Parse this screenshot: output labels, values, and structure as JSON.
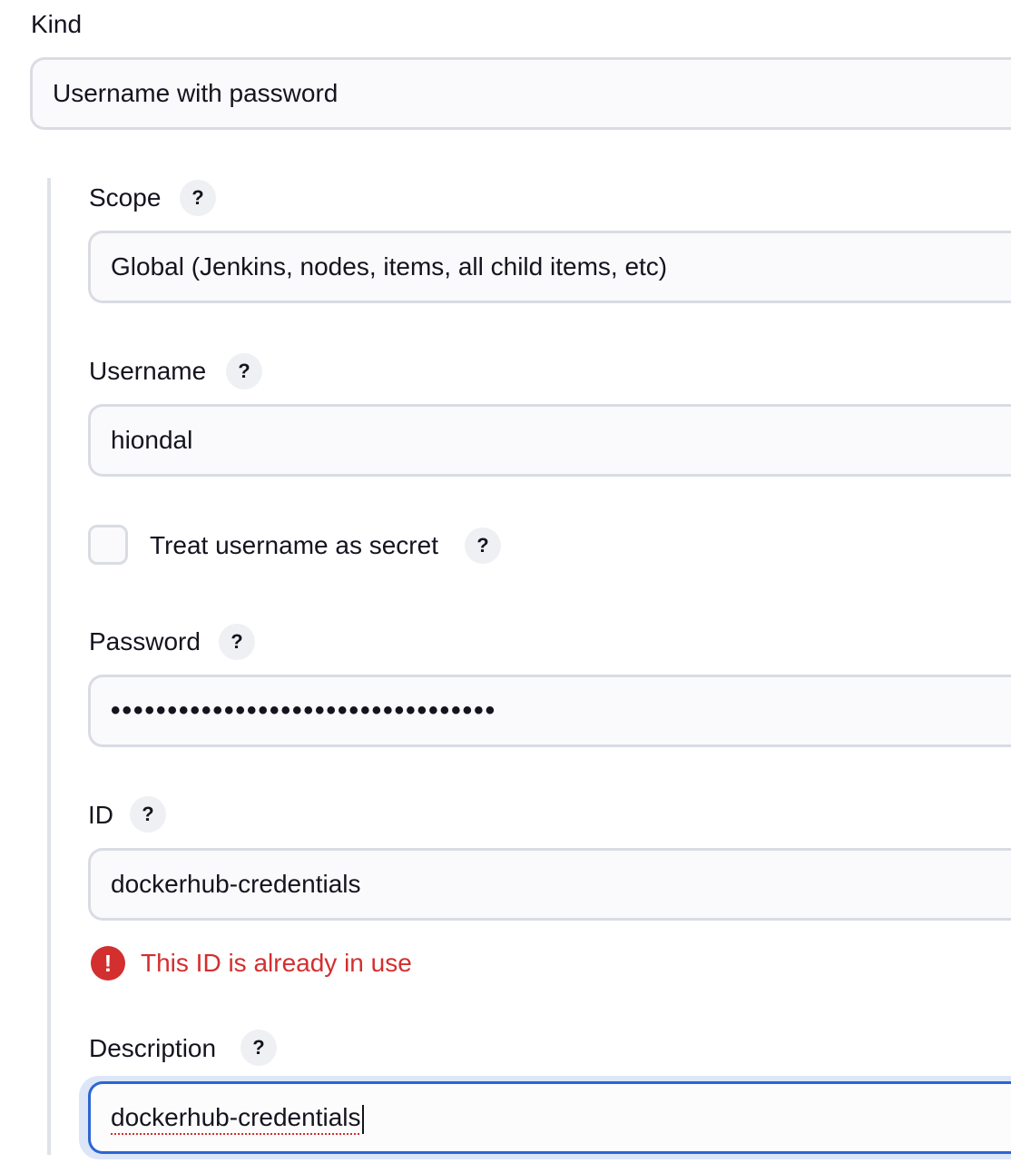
{
  "kind": {
    "label": "Kind",
    "value": "Username with password"
  },
  "scope": {
    "label": "Scope",
    "help": "?",
    "value": "Global (Jenkins, nodes, items, all child items, etc)"
  },
  "username": {
    "label": "Username",
    "help": "?",
    "value": "hiondal"
  },
  "treat_secret": {
    "label": "Treat username as secret",
    "help": "?",
    "checked": false
  },
  "password": {
    "label": "Password",
    "help": "?",
    "masked_value": "••••••••••••••••••••••••••••••••••"
  },
  "id": {
    "label": "ID",
    "help": "?",
    "value": "dockerhub-credentials",
    "error": "This ID is already in use",
    "error_icon": "!"
  },
  "description": {
    "label": "Description",
    "help": "?",
    "value": "dockerhub-credentials"
  },
  "colors": {
    "error": "#d32f2f",
    "focus": "#2c66d2",
    "field_border": "#d9dce3"
  }
}
